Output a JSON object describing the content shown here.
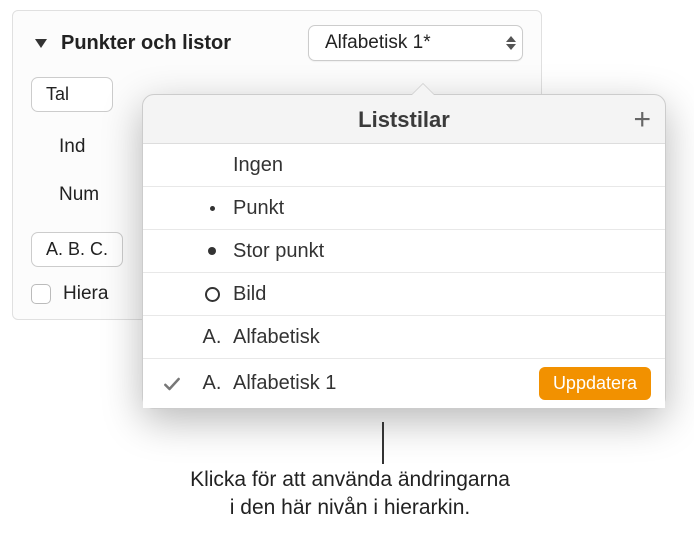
{
  "section": {
    "title": "Punkter och listor",
    "dropdown_value": "Alfabetisk 1*"
  },
  "rows": {
    "tal": "Tal",
    "ind": "Ind",
    "num": "Num",
    "abc": "A. B. C.",
    "hiera": "Hiera"
  },
  "popover": {
    "title": "Liststilar",
    "items": [
      {
        "marker": "none",
        "label": "Ingen",
        "selected": false
      },
      {
        "marker": "dot-small",
        "label": "Punkt",
        "selected": false
      },
      {
        "marker": "dot-big",
        "label": "Stor punkt",
        "selected": false
      },
      {
        "marker": "ring",
        "label": "Bild",
        "selected": false
      },
      {
        "marker": "A.",
        "label": "Alfabetisk",
        "selected": false
      },
      {
        "marker": "A.",
        "label": "Alfabetisk 1",
        "selected": true,
        "update": true
      }
    ],
    "update_label": "Uppdatera"
  },
  "caption": {
    "line1": "Klicka för att använda ändringarna",
    "line2": "i den här nivån i hierarkin."
  }
}
